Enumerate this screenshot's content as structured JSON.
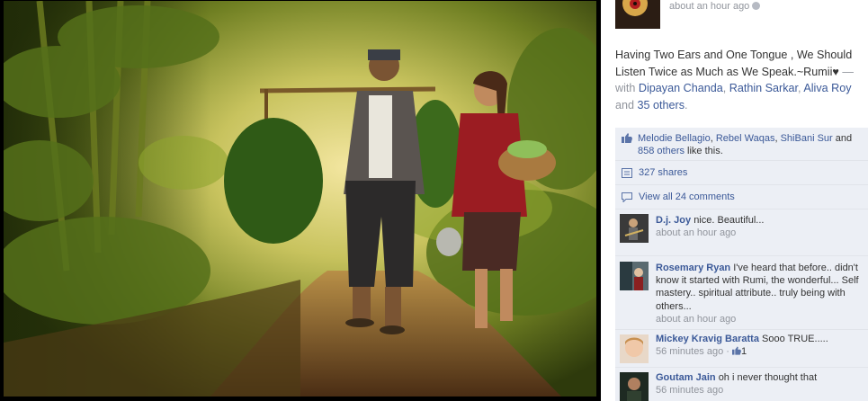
{
  "post": {
    "timestamp": "about an hour ago",
    "caption": "Having Two Ears and One Tongue , We Should Listen Twice as Much as We Speak.~Rumii♥",
    "with_prefix": "— with",
    "tagged": [
      "Dipayan Chanda",
      "Rathin Sarkar",
      "Aliva Roy"
    ],
    "tagged_sep_1": ",",
    "tagged_and": "and",
    "others": "35 others",
    "end_punct": "."
  },
  "likes": {
    "names": [
      "Melodie Bellagio",
      "Rebel Waqas",
      "ShiBani Sur"
    ],
    "and": "and",
    "others": "858 others",
    "suffix": "like this."
  },
  "shares": {
    "label": "327 shares"
  },
  "comments_link": {
    "label": "View all 24 comments"
  },
  "comments": [
    {
      "name": "D.j. Joy",
      "text": "nice. Beautiful...",
      "time": "about an hour ago"
    },
    {
      "name": "Rosemary Ryan",
      "text": "I've heard that before.. didn't know it started with Rumi, the wonderful... Self mastery.. spiritual attribute.. truly being with others...",
      "time": "about an hour ago"
    },
    {
      "name": "Mickey Kravig Baratta",
      "text": "Sooo TRUE.....",
      "time": "56 minutes ago",
      "sep": "·",
      "likes": "1"
    },
    {
      "name": "Goutam Jain",
      "text": "oh i never thought that",
      "time": "56 minutes ago"
    }
  ],
  "colors": {
    "link": "#3b5998",
    "muted": "#90949c",
    "panel_box": "#eceff5"
  }
}
